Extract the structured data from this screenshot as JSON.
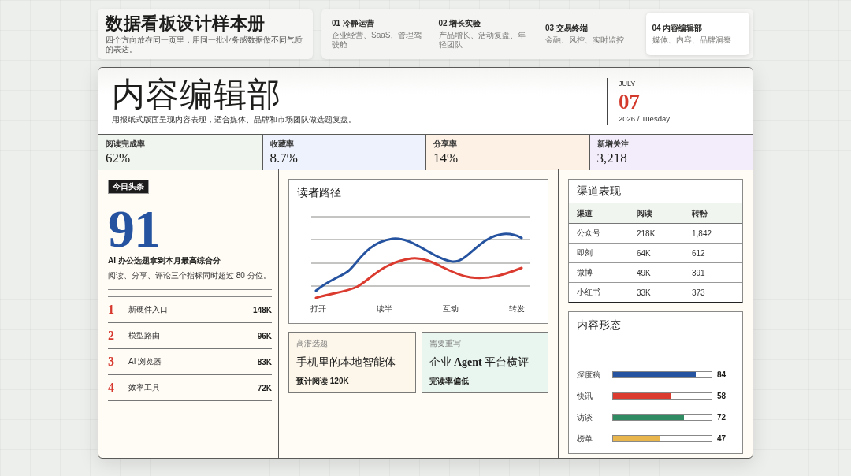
{
  "cover": {
    "title": "数据看板设计样本册",
    "subtitle": "四个方向放在同一页里，用同一批业务感数据做不同气质的表达。"
  },
  "tabs": [
    {
      "label": "01 冷静运营",
      "description": "企业经营、SaaS、管理驾驶舱",
      "selected": false
    },
    {
      "label": "02 增长实验",
      "description": "产品增长、活动复盘、年轻团队",
      "selected": false
    },
    {
      "label": "03 交易终端",
      "description": "金融、风控、实时监控",
      "selected": false
    },
    {
      "label": "04 内容编辑部",
      "description": "媒体、内容、品牌洞察",
      "selected": true
    }
  ],
  "masthead": {
    "title": "内容编辑部",
    "subtitle": "用报纸式版面呈现内容表现，适合媒体、品牌和市场团队做选题复盘。",
    "month": "JULY",
    "day": "07",
    "year_weekday": "2026 / Tuesday"
  },
  "kpis": [
    {
      "label": "阅读完成率",
      "value": "62%",
      "color": "#f1f5ef"
    },
    {
      "label": "收藏率",
      "value": "8.7%",
      "color": "#eef2fd"
    },
    {
      "label": "分享率",
      "value": "14%",
      "color": "#fdf1e6"
    },
    {
      "label": "新增关注",
      "value": "3,218",
      "color": "#f3edfb"
    }
  ],
  "headline": {
    "badge": "今日头条",
    "score": "91",
    "title": "AI 办公选题拿到本月最高综合分",
    "summary": "阅读、分享、评论三个指标同时超过 80 分位。",
    "ranking": [
      {
        "rank": "1",
        "name": "新硬件入口",
        "value": "148K"
      },
      {
        "rank": "2",
        "name": "模型路由",
        "value": "96K"
      },
      {
        "rank": "3",
        "name": "AI 浏览器",
        "value": "83K"
      },
      {
        "rank": "4",
        "name": "效率工具",
        "value": "72K"
      }
    ]
  },
  "reader_path": {
    "title": "读者路径",
    "stages": [
      "打开",
      "读半",
      "互动",
      "转发"
    ]
  },
  "topic_cards": [
    {
      "tag": "高潜选题",
      "title": "手机里的本地智能体",
      "note": "预计阅读 120K",
      "color": "#fdf6ea"
    },
    {
      "tag": "需要重写",
      "title": "企业 **Agent** 平台横评",
      "note": "完读率偏低",
      "color": "#e9f6ef"
    }
  ],
  "channels": {
    "title": "渠道表现",
    "columns": [
      "渠道",
      "阅读",
      "转粉"
    ],
    "rows": [
      [
        "公众号",
        "218K",
        "1,842"
      ],
      [
        "即刻",
        "64K",
        "612"
      ],
      [
        "微博",
        "49K",
        "391"
      ],
      [
        "小红书",
        "33K",
        "373"
      ]
    ]
  },
  "formats": {
    "title": "内容形态",
    "items": [
      {
        "label": "深度稿",
        "level": 0.84,
        "value": "84",
        "color": "#2553a0"
      },
      {
        "label": "快讯",
        "level": 0.58,
        "value": "58",
        "color": "#db3a2f"
      },
      {
        "label": "访谈",
        "level": 0.72,
        "value": "72",
        "color": "#2f8b62"
      },
      {
        "label": "榜单",
        "level": 0.47,
        "value": "47",
        "color": "#e7b54b"
      }
    ]
  }
}
